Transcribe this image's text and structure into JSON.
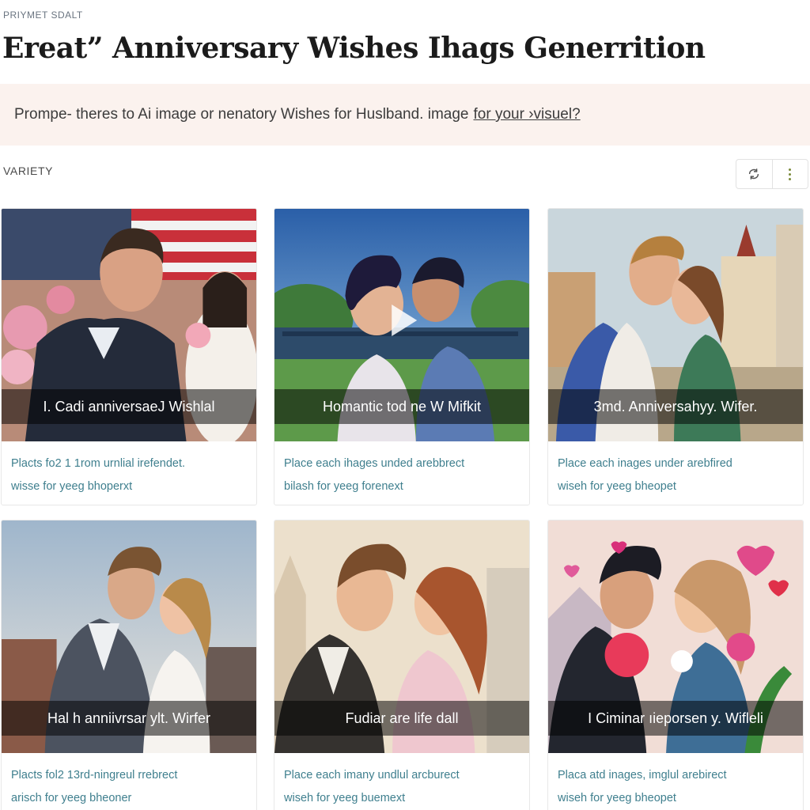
{
  "header": {
    "eyebrow": "PRIYMET SDALT",
    "title": "Ereat” Anniversary Wishes Ihags Generrition"
  },
  "prompt": {
    "text": "Prompe- theres to Ai image or  nenatory Wishes for Huslband. image",
    "link": "for your ›visuel?"
  },
  "section": {
    "label": "VARIETY"
  },
  "toolbar": {
    "refresh_icon": "refresh-icon",
    "more_icon": "more-vertical-icon"
  },
  "cards": [
    {
      "caption": "I. Cadi anniversaeJ Wishlal",
      "desc1": "Placts fo2 1 1rom urnlial irefendet.",
      "desc2": "wisse for yeeg bhoperxt"
    },
    {
      "caption": "Homantic tod ne W Mifkit",
      "desc1": "Place each ihages unded arebbrect",
      "desc2": "bilash for yeeg forenext"
    },
    {
      "caption": "3md. Anniversahyy. Wifer.",
      "desc1": "Place each inages under arebfired",
      "desc2": "wiseh for yeeg bheopet"
    },
    {
      "caption": "Hal h anniivrsar ylt. Wirfer",
      "desc1": "Placts fol2 13rd-ningreul rrebrect",
      "desc2": "arisch for yeeg bheoner"
    },
    {
      "caption": "Fudiar are life dall",
      "desc1": "Place each imany undlul arcburect",
      "desc2": "wiseh for yeeg buemext"
    },
    {
      "caption": "I Ciminar ıieporsen y. Wifleli",
      "desc1": "Placa atd inages, imglul arebirect",
      "desc2": "wiseh for yeeg bheopet"
    }
  ],
  "colors": {
    "accent_link": "#3f7f8e",
    "prompt_bg": "#fbf2ee",
    "kebab": "#7a8a3a"
  }
}
